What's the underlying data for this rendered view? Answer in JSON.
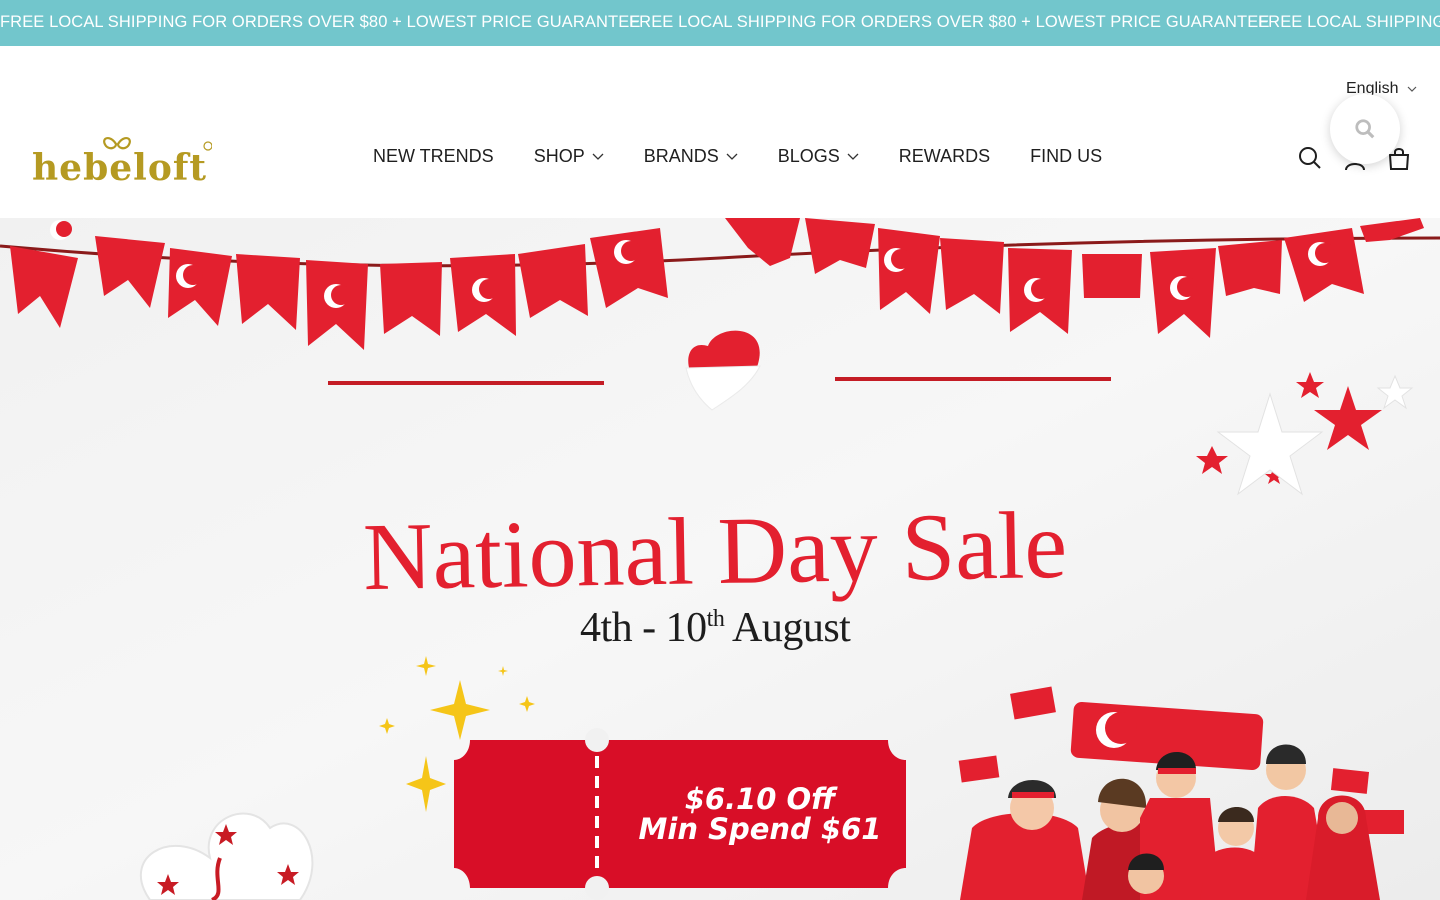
{
  "announcement": {
    "message": "FREE LOCAL SHIPPING FOR ORDERS OVER $80 + LOWEST PRICE GUARANTEE",
    "message_2": "FREE LOCAL SHIPPING FOR ORDERS OVER $80 + LOWEST PRICE GUARANTEE",
    "message_3": "FREE LOCAL SHIPPING FO",
    "bg_color": "#72c6cc"
  },
  "header": {
    "logo_text": "hebeloft",
    "language": "English",
    "nav": [
      {
        "label": "NEW TRENDS",
        "has_dropdown": false
      },
      {
        "label": "SHOP",
        "has_dropdown": true
      },
      {
        "label": "BRANDS",
        "has_dropdown": true
      },
      {
        "label": "BLOGS",
        "has_dropdown": true
      },
      {
        "label": "REWARDS",
        "has_dropdown": false
      },
      {
        "label": "FIND US",
        "has_dropdown": false
      }
    ],
    "icons": [
      "search-icon",
      "account-icon",
      "cart-icon"
    ]
  },
  "hero": {
    "title": "National Day Sale",
    "dates_main": "4th - 10",
    "dates_sup": "th",
    "dates_month": " August",
    "voucher_line1": "$6.10 Off",
    "voucher_line2": "Min Spend $61",
    "accent_color": "#e0202e"
  }
}
